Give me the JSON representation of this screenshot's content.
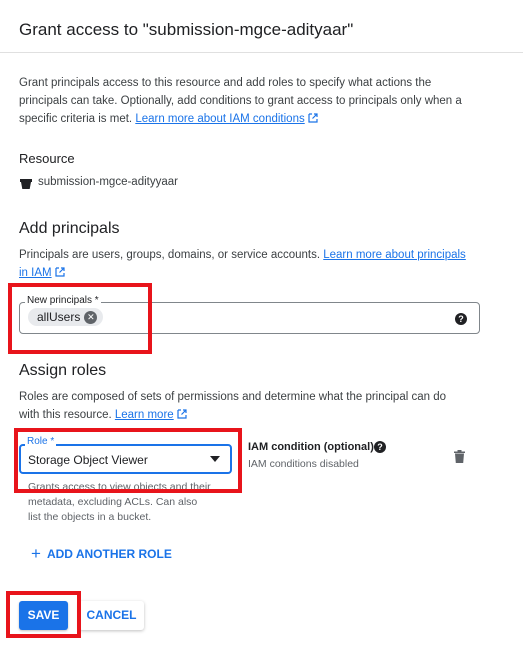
{
  "dialog": {
    "title": "Grant access to \"submission-mgce-adityaar\""
  },
  "intro": {
    "line1": "Grant principals access to this resource and add roles to specify what actions the",
    "line2": "principals can take. Optionally, add conditions to grant access to principals only when a",
    "line3_prefix": "specific criteria is met. ",
    "link": "Learn more about IAM conditions"
  },
  "resource": {
    "heading": "Resource",
    "name": "submission-mgce-adityyaar"
  },
  "principals": {
    "heading": "Add principals",
    "desc_prefix": "Principals are users, groups, domains, or service accounts. ",
    "link_part1": "Learn more about principals",
    "link_part2": "in IAM",
    "field_label": "New principals *",
    "chip_value": "allUsers"
  },
  "roles": {
    "heading": "Assign roles",
    "desc_line1": "Roles are composed of sets of permissions and determine what the principal can do",
    "desc_line2_prefix": "with this resource. ",
    "link": "Learn more",
    "role_label": "Role *",
    "role_value": "Storage Object Viewer",
    "role_help_line1": "Grants access to view objects and their",
    "role_help_line2": "metadata, excluding ACLs. Can also",
    "role_help_line3": "list the objects in a bucket.",
    "condition_label": "IAM condition (optional)",
    "condition_status": "IAM conditions disabled",
    "add_role": "ADD ANOTHER ROLE"
  },
  "actions": {
    "save": "SAVE",
    "cancel": "CANCEL"
  },
  "colors": {
    "accent": "#1a73e8",
    "highlight": "#e8141b",
    "text": "#202124"
  },
  "icons": [
    "bucket-icon",
    "external-link-icon",
    "chip-remove-icon",
    "help-icon",
    "dropdown-arrow-icon",
    "trash-icon",
    "plus-icon"
  ]
}
